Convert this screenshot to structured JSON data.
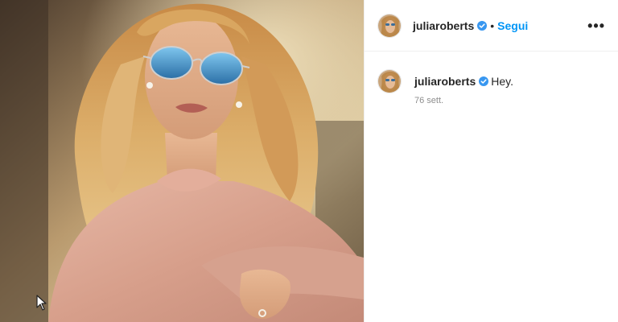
{
  "post": {
    "image": {
      "subject": "portrait-photo"
    },
    "header": {
      "username": "juliaroberts",
      "separator": "•",
      "follow_label": "Segui",
      "more_icon": "more-options-icon"
    },
    "caption": {
      "username": "juliaroberts",
      "text": "Hey.",
      "timestamp": "76 sett."
    },
    "colors": {
      "accent": "#0095f6",
      "verified": "#3897f0",
      "text": "#262626",
      "muted": "#8e8e8e"
    }
  }
}
